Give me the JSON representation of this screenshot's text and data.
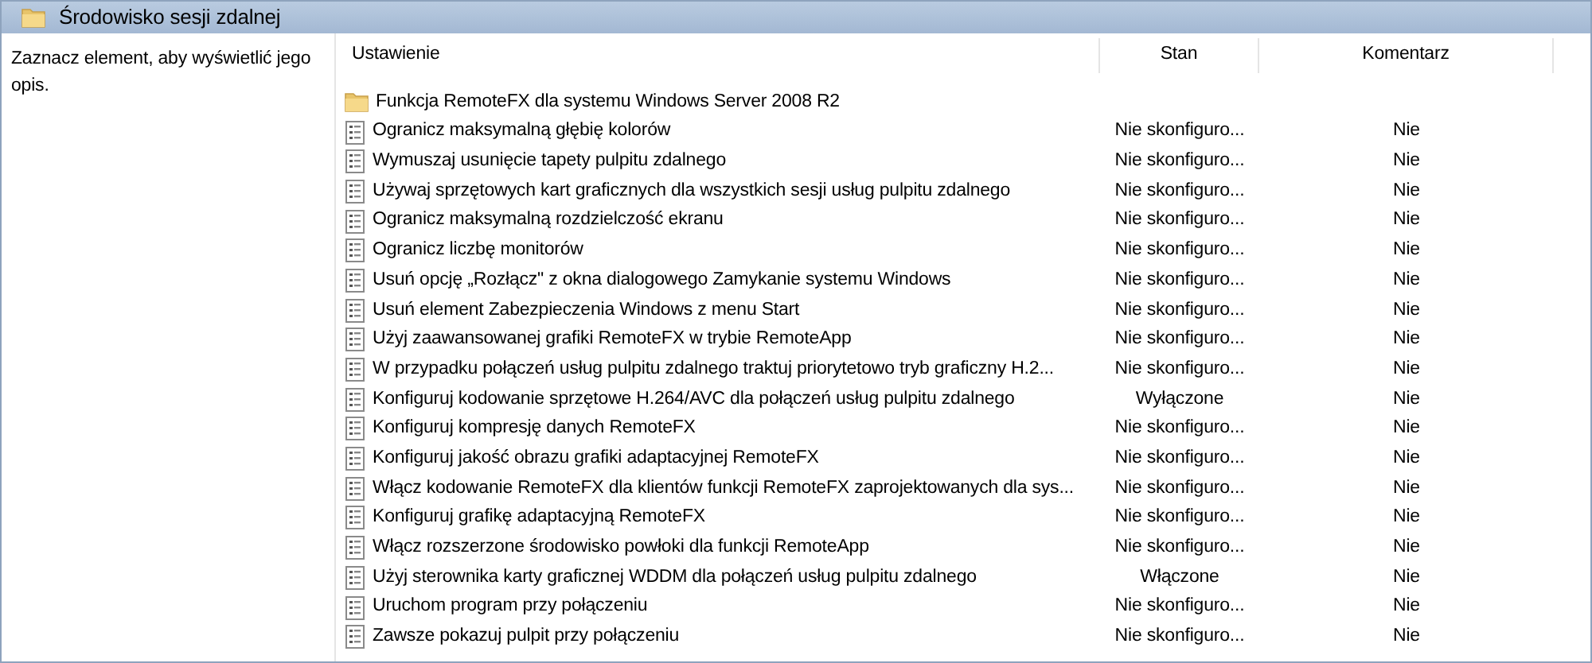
{
  "header": {
    "title": "Środowisko sesji zdalnej"
  },
  "description": "Zaznacz element, aby wyświetlić jego opis.",
  "table": {
    "columns": [
      "Ustawienie",
      "Stan",
      "Komentarz"
    ],
    "rows": [
      {
        "kind": "folder",
        "name": "Funkcja RemoteFX dla systemu Windows Server 2008 R2"
      },
      {
        "kind": "policy",
        "name": "Ogranicz maksymalną głębię kolorów",
        "state": "Nie skonfiguro...",
        "comment": "Nie"
      },
      {
        "kind": "policy",
        "name": "Wymuszaj usunięcie tapety pulpitu zdalnego",
        "state": "Nie skonfiguro...",
        "comment": "Nie"
      },
      {
        "kind": "policy",
        "name": "Używaj sprzętowych kart graficznych dla wszystkich sesji usług pulpitu zdalnego",
        "state": "Nie skonfiguro...",
        "comment": "Nie"
      },
      {
        "kind": "policy",
        "name": "Ogranicz maksymalną rozdzielczość ekranu",
        "state": "Nie skonfiguro...",
        "comment": "Nie"
      },
      {
        "kind": "policy",
        "name": "Ogranicz liczbę monitorów",
        "state": "Nie skonfiguro...",
        "comment": "Nie"
      },
      {
        "kind": "policy",
        "name": "Usuń opcję „Rozłącz\" z okna dialogowego Zamykanie systemu Windows",
        "state": "Nie skonfiguro...",
        "comment": "Nie"
      },
      {
        "kind": "policy",
        "name": "Usuń element Zabezpieczenia Windows z menu Start",
        "state": "Nie skonfiguro...",
        "comment": "Nie"
      },
      {
        "kind": "policy",
        "name": "Użyj zaawansowanej grafiki RemoteFX w trybie RemoteApp",
        "state": "Nie skonfiguro...",
        "comment": "Nie"
      },
      {
        "kind": "policy",
        "name": "W przypadku połączeń usług pulpitu zdalnego traktuj priorytetowo tryb graficzny H.2...",
        "state": "Nie skonfiguro...",
        "comment": "Nie"
      },
      {
        "kind": "policy",
        "name": "Konfiguruj kodowanie sprzętowe H.264/AVC dla połączeń usług pulpitu zdalnego",
        "state": "Wyłączone",
        "comment": "Nie"
      },
      {
        "kind": "policy",
        "name": "Konfiguruj kompresję danych RemoteFX",
        "state": "Nie skonfiguro...",
        "comment": "Nie"
      },
      {
        "kind": "policy",
        "name": "Konfiguruj jakość obrazu grafiki adaptacyjnej RemoteFX",
        "state": "Nie skonfiguro...",
        "comment": "Nie"
      },
      {
        "kind": "policy",
        "name": "Włącz kodowanie RemoteFX dla klientów funkcji RemoteFX zaprojektowanych dla sys...",
        "state": "Nie skonfiguro...",
        "comment": "Nie"
      },
      {
        "kind": "policy",
        "name": "Konfiguruj grafikę adaptacyjną RemoteFX",
        "state": "Nie skonfiguro...",
        "comment": "Nie"
      },
      {
        "kind": "policy",
        "name": "Włącz rozszerzone środowisko powłoki dla funkcji RemoteApp",
        "state": "Nie skonfiguro...",
        "comment": "Nie"
      },
      {
        "kind": "policy",
        "name": "Użyj sterownika karty graficznej WDDM dla połączeń usług pulpitu zdalnego",
        "state": "Włączone",
        "comment": "Nie"
      },
      {
        "kind": "policy",
        "name": "Uruchom program przy połączeniu",
        "state": "Nie skonfiguro...",
        "comment": "Nie"
      },
      {
        "kind": "policy",
        "name": "Zawsze pokazuj pulpit przy połączeniu",
        "state": "Nie skonfiguro...",
        "comment": "Nie"
      }
    ]
  }
}
